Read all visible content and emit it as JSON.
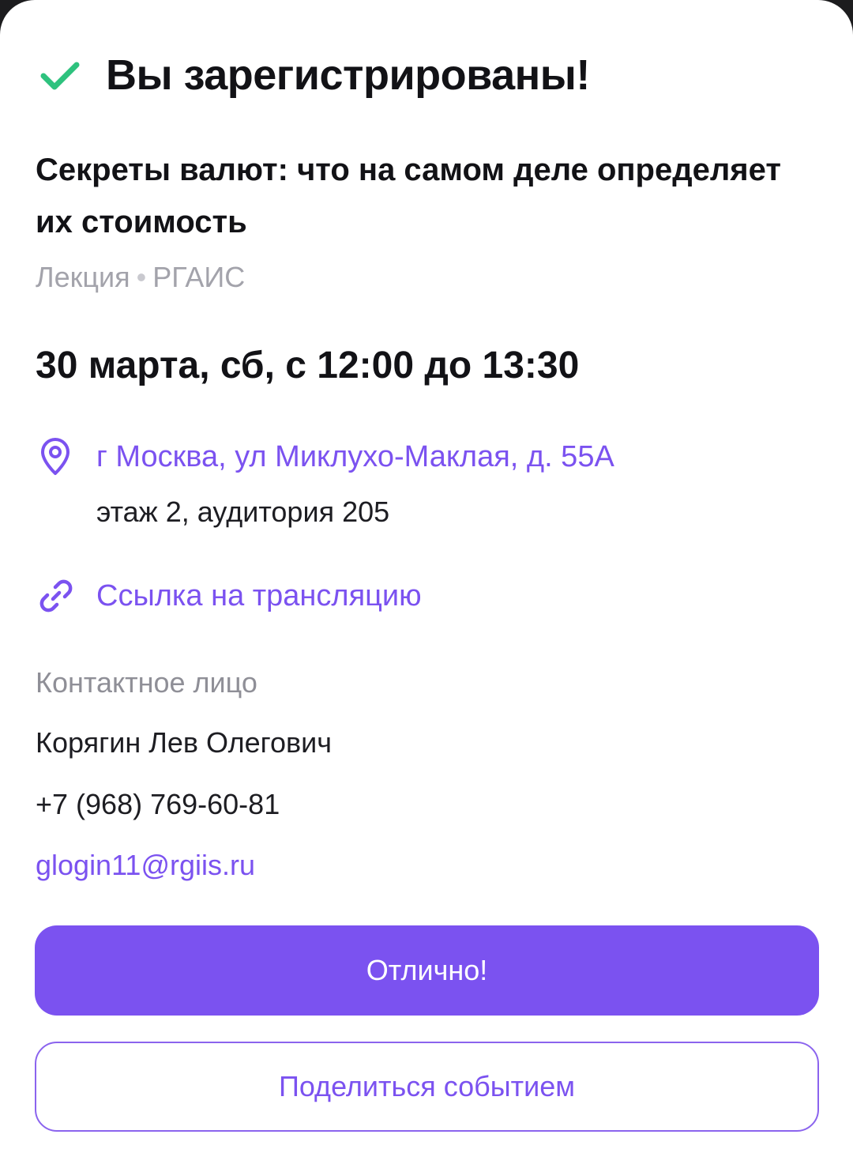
{
  "dialog": {
    "title": "Вы зарегистрированы!",
    "check_icon": "checkmark-icon",
    "colors": {
      "accent": "#7b52f0",
      "success": "#2ec27e",
      "text_primary": "#121216",
      "text_secondary": "#a3a3ab"
    }
  },
  "event": {
    "title": "Секреты валют: что на самом деле определяет их стоимость",
    "type": "Лекция",
    "separator": "•",
    "organizer": "РГАИС",
    "datetime": "30 марта, сб, с 12:00 до 13:30",
    "address": "г Москва, ул Миклухо-Маклая, д. 55А",
    "address_details": "этаж 2, аудитория 205",
    "location_icon": "map-pin-icon",
    "stream_link_label": "Ссылка на трансляцию",
    "stream_icon": "link-icon"
  },
  "contact": {
    "label": "Контактное лицо",
    "name": "Корягин Лев Олегович",
    "phone": "+7 (968) 769-60-81",
    "email": "glogin11@rgiis.ru"
  },
  "actions": {
    "primary_label": "Отлично!",
    "secondary_label": "Поделиться событием"
  }
}
